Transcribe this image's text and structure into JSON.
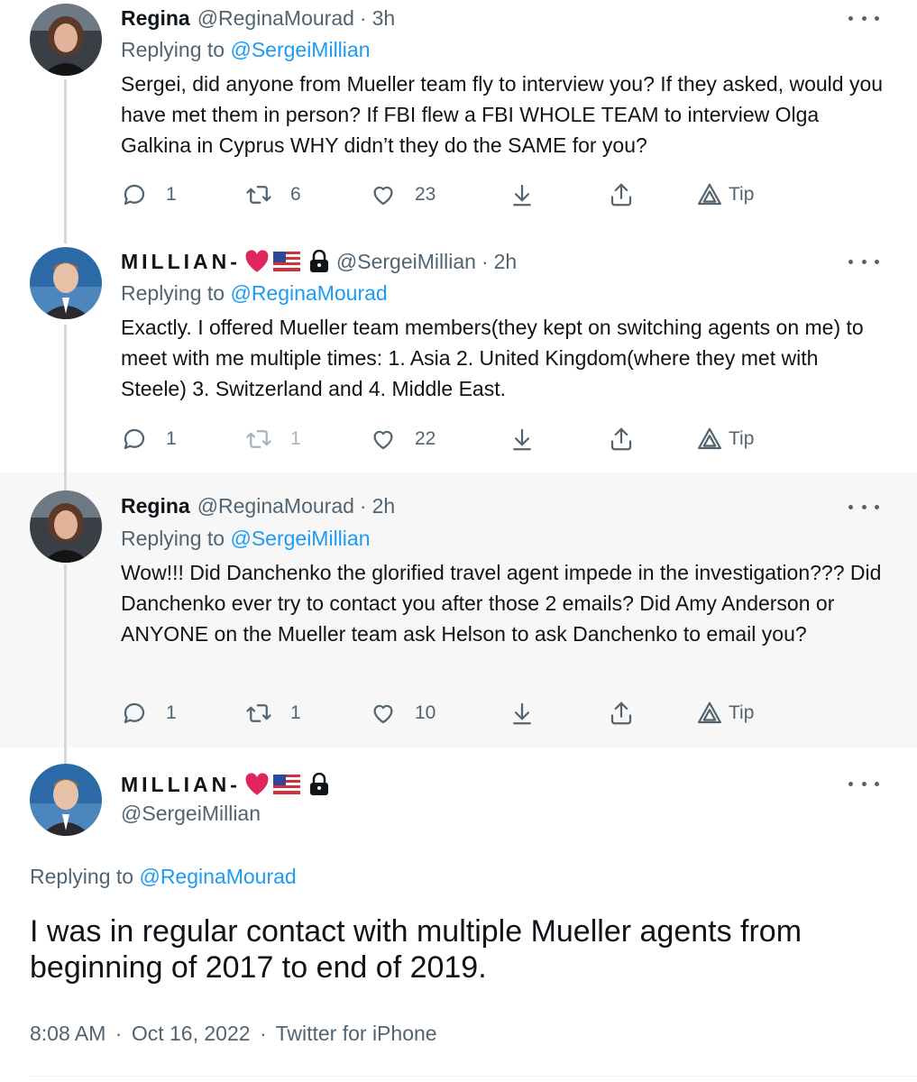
{
  "tweets": [
    {
      "name": "Regina",
      "handle": "@ReginaMourad",
      "time": "3h",
      "reply_prefix": "Replying to",
      "reply_to": "@SergeiMillian",
      "text": "Sergei, did anyone from Mueller team fly to interview you? If they asked, would you have met them in person? If FBI flew a FBI WHOLE TEAM to interview Olga Galkina in Cyprus WHY didn’t they do the SAME for you?",
      "replies": "1",
      "retweets": "6",
      "likes": "23",
      "tip": "Tip"
    },
    {
      "name": "MILLIAN-",
      "handle": "@SergeiMillian",
      "time": "2h",
      "reply_prefix": "Replying to",
      "reply_to": "@ReginaMourad",
      "text": "Exactly. I offered Mueller team members(they kept on switching agents on me) to meet with me multiple times: 1. Asia 2. United Kingdom(where they met with Steele) 3. Switzerland and 4. Middle East.",
      "replies": "1",
      "retweets": "1",
      "likes": "22",
      "tip": "Tip"
    },
    {
      "name": "Regina",
      "handle": "@ReginaMourad",
      "time": "2h",
      "reply_prefix": "Replying to",
      "reply_to": "@SergeiMillian",
      "text": "Wow!!! Did Danchenko the glorified travel agent impede in the investigation??? Did Danchenko ever try to contact you after those 2 emails? Did Amy Anderson or ANYONE on the Mueller team ask Helson to ask Danchenko to email you?",
      "replies": "1",
      "retweets": "1",
      "likes": "10",
      "tip": "Tip"
    }
  ],
  "main_tweet": {
    "name": "MILLIAN-",
    "handle": "@SergeiMillian",
    "reply_prefix": "Replying to",
    "reply_to": "@ReginaMourad",
    "text": "I was in regular contact with multiple Mueller agents from beginning of 2017 to end of 2019.",
    "time": "8:08 AM",
    "date": "Oct 16, 2022",
    "source": "Twitter for iPhone"
  },
  "separator": "·",
  "colors": {
    "text": "#0f1419",
    "secondary": "#536471",
    "link": "#1d9bf0",
    "heart": "#e0245e",
    "highlight_bg": "#f7f7f7"
  }
}
